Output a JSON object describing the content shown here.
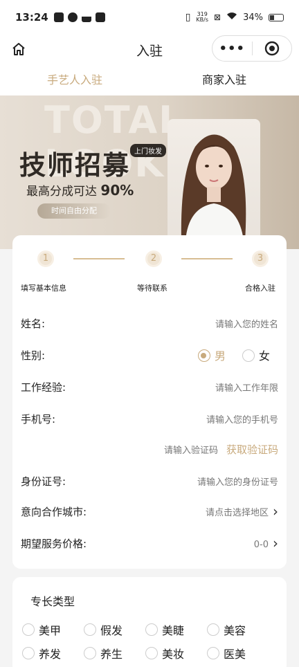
{
  "status": {
    "time": "13:24",
    "net_speed_value": "319",
    "net_speed_unit": "KB/s",
    "battery": "34%"
  },
  "nav": {
    "title": "入驻",
    "more": "•••"
  },
  "tabs": [
    {
      "label": "手艺人入驻",
      "active": true
    },
    {
      "label": "商家入驻",
      "active": false
    }
  ],
  "banner": {
    "bg_text": "TOTAL LOOK",
    "headline": "技师招募",
    "tag": "上门妆发",
    "subline_prefix": "最高分成可达",
    "subline_value": "90%",
    "pill": "时间自由分配"
  },
  "steps": [
    {
      "num": "1",
      "label": "填写基本信息"
    },
    {
      "num": "2",
      "label": "等待联系"
    },
    {
      "num": "3",
      "label": "合格入驻"
    }
  ],
  "form": {
    "name_label": "姓名:",
    "name_placeholder": "请输入您的姓名",
    "gender_label": "性别:",
    "gender_male": "男",
    "gender_female": "女",
    "gender_selected": "男",
    "exp_label": "工作经验:",
    "exp_placeholder": "请输入工作年限",
    "phone_label": "手机号:",
    "phone_placeholder": "请输入您的手机号",
    "code_placeholder": "请输入验证码",
    "code_button": "获取验证码",
    "id_label": "身份证号:",
    "id_placeholder": "请输入您的身份证号",
    "city_label": "意向合作城市:",
    "city_placeholder": "请点击选择地区",
    "price_label": "期望服务价格:",
    "price_value": "0-0"
  },
  "skills": {
    "title": "专长类型",
    "items": [
      "美甲",
      "假发",
      "美睫",
      "美容",
      "养发",
      "养生",
      "美妆",
      "医美"
    ]
  },
  "colors": {
    "accent": "#c8aa7d"
  }
}
